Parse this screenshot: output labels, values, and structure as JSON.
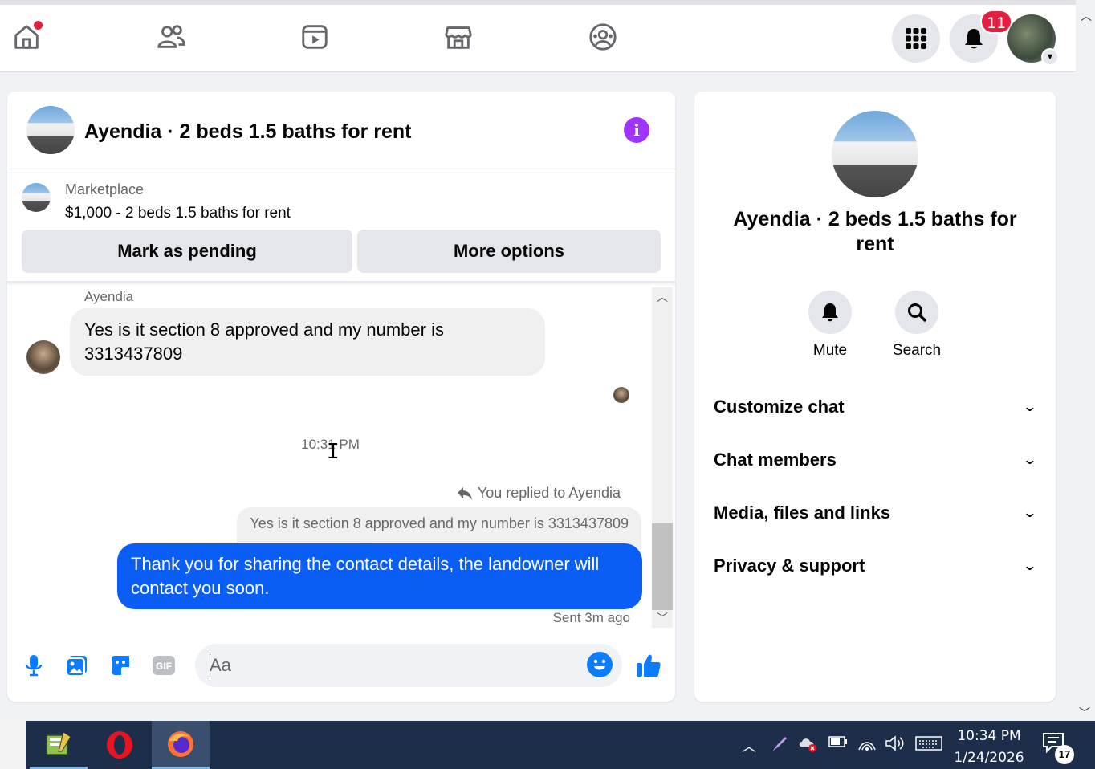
{
  "topnav": {
    "notifications_count": "11",
    "icons": [
      "home-icon",
      "friends-icon",
      "video-icon",
      "marketplace-icon",
      "groups-icon",
      "menu-grid-icon",
      "notifications-bell-icon",
      "profile-avatar"
    ]
  },
  "chat": {
    "title": "Ayendia · 2 beds 1.5 baths for rent",
    "marketplace_label": "Marketplace",
    "listing": "$1,000 - 2 beds 1.5 baths for rent",
    "mark_pending": "Mark as pending",
    "more_options": "More options",
    "messages": {
      "sender": "Ayendia",
      "incoming_text": "Yes is it section 8 approved and my number is 3313437809",
      "timestamp": "10:31 PM",
      "replied_label": "You replied to Ayendia",
      "quoted_text": "Yes is it section 8 approved and my number is 3313437809",
      "outgoing_text": "Thank you for sharing the contact details, the landowner will contact you soon.",
      "sent_status": "Sent 3m ago"
    },
    "composer": {
      "placeholder": "Aa",
      "gif_label": "GIF"
    }
  },
  "info_panel": {
    "title": "Ayendia · 2 beds 1.5 baths for rent",
    "mute_label": "Mute",
    "search_label": "Search",
    "sections": [
      "Customize chat",
      "Chat members",
      "Media, files and links",
      "Privacy & support"
    ]
  },
  "taskbar": {
    "time": "10:34 PM",
    "date": "1/24/2026",
    "notification_count": "17"
  },
  "colors": {
    "accent_blue": "#0a5df5",
    "info_purple": "#a033ff",
    "badge_red": "#e41e3f",
    "taskbar": "#1c2e4a"
  }
}
